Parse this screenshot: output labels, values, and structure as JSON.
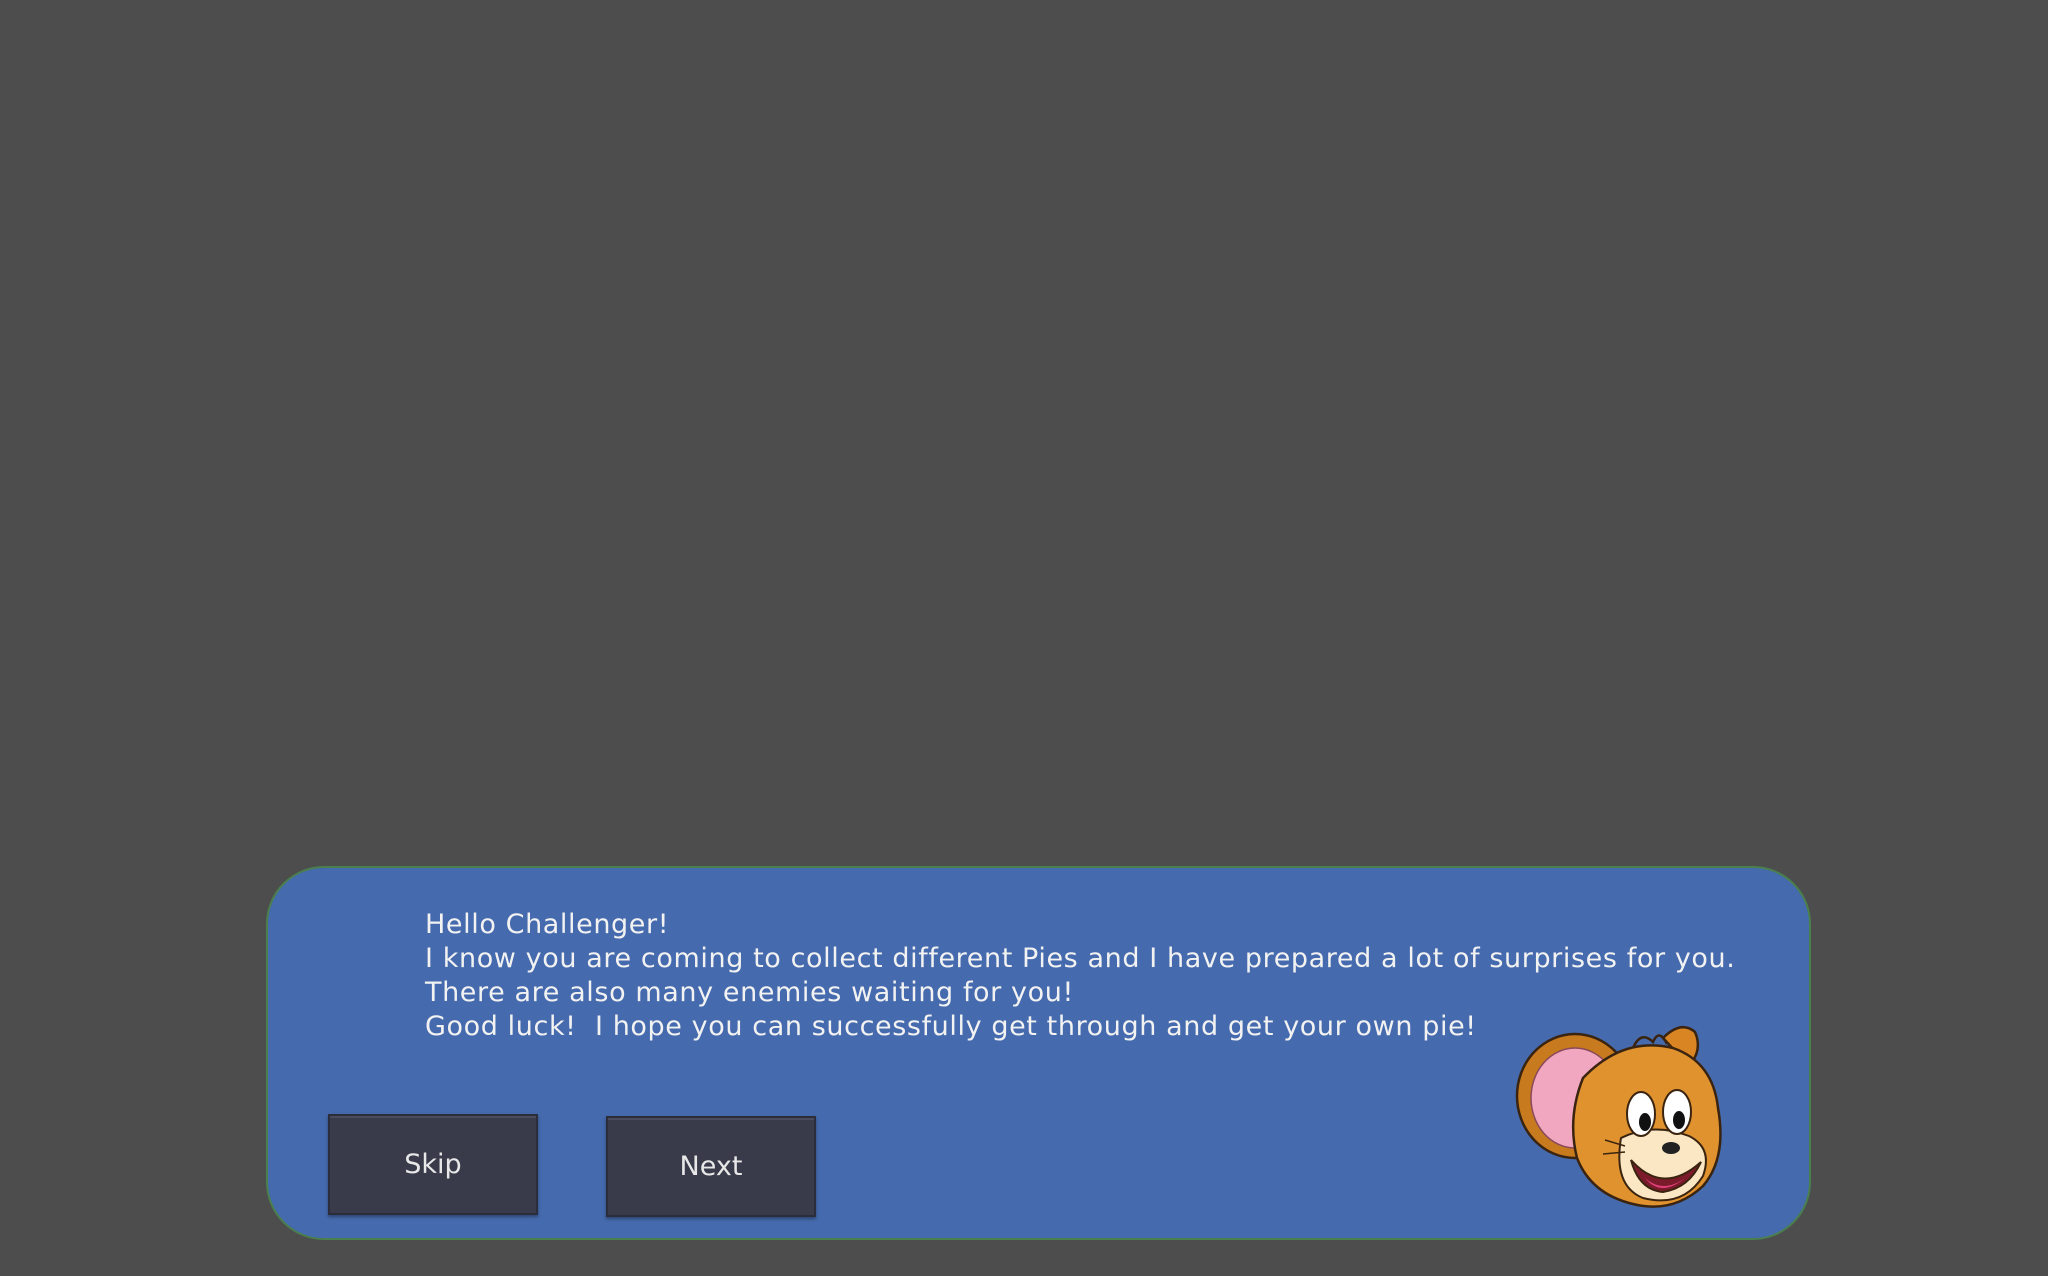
{
  "dialog": {
    "lines": [
      "Hello Challenger!",
      "I know you are coming to collect different Pies and I have prepared a lot of surprises for you.",
      "There are also many enemies waiting for you!",
      "Good luck!  I hope you can successfully get through and get your own pie!"
    ],
    "skip_label": "Skip",
    "next_label": "Next",
    "mascot_icon": "mouse-character-icon"
  },
  "colors": {
    "background": "#4d4d4d",
    "dialog_fill": "#456aad",
    "button_fill": "#393a4a",
    "text": "#f2f2f2"
  }
}
